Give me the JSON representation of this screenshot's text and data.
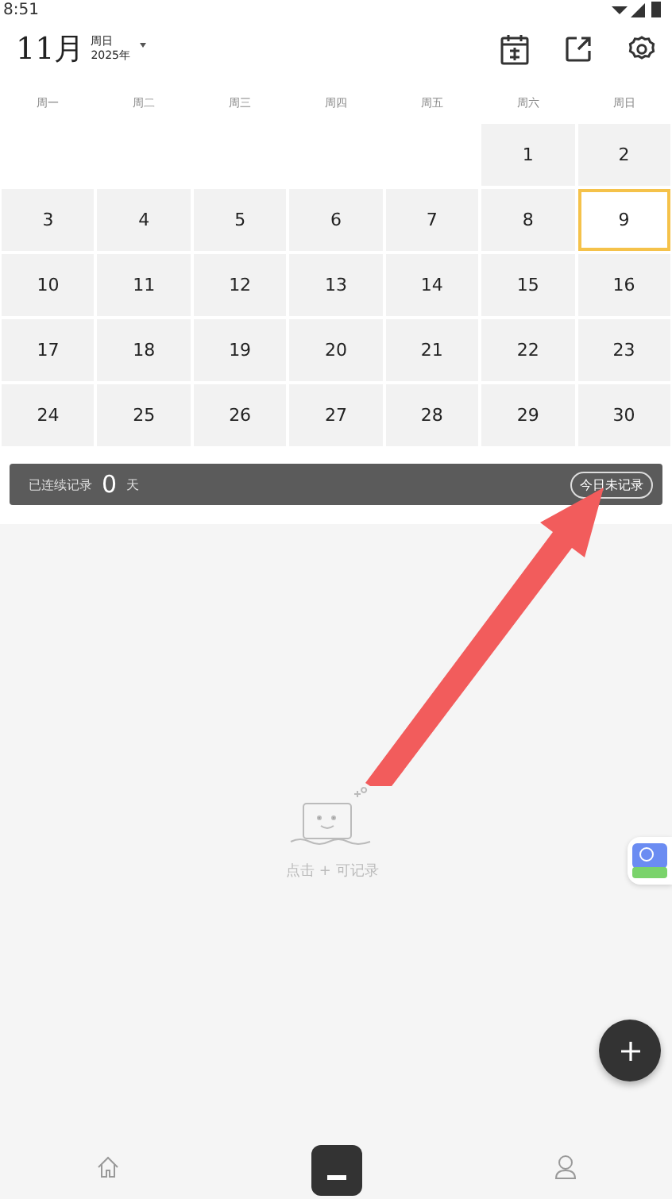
{
  "status_bar": {
    "time": "8:51"
  },
  "header": {
    "month": "11月",
    "weekday": "周日",
    "year": "2025年"
  },
  "weekdays": [
    "周一",
    "周二",
    "周三",
    "周四",
    "周五",
    "周六",
    "周日"
  ],
  "weeks": [
    [
      {
        "kind": "blank"
      },
      {
        "kind": "blank"
      },
      {
        "kind": "blank"
      },
      {
        "kind": "blank"
      },
      {
        "kind": "blank"
      },
      {
        "day": "1",
        "selected": false
      },
      {
        "day": "2",
        "selected": false
      }
    ],
    [
      {
        "day": "3",
        "selected": false
      },
      {
        "day": "4",
        "selected": false
      },
      {
        "day": "5",
        "selected": false
      },
      {
        "day": "6",
        "selected": false
      },
      {
        "day": "7",
        "selected": false
      },
      {
        "day": "8",
        "selected": false
      },
      {
        "day": "9",
        "selected": true
      }
    ],
    [
      {
        "day": "10",
        "selected": false
      },
      {
        "day": "11",
        "selected": false
      },
      {
        "day": "12",
        "selected": false
      },
      {
        "day": "13",
        "selected": false
      },
      {
        "day": "14",
        "selected": false
      },
      {
        "day": "15",
        "selected": false
      },
      {
        "day": "16",
        "selected": false
      }
    ],
    [
      {
        "day": "17",
        "selected": false
      },
      {
        "day": "18",
        "selected": false
      },
      {
        "day": "19",
        "selected": false
      },
      {
        "day": "20",
        "selected": false
      },
      {
        "day": "21",
        "selected": false
      },
      {
        "day": "22",
        "selected": false
      },
      {
        "day": "23",
        "selected": false
      }
    ],
    [
      {
        "day": "24",
        "selected": false
      },
      {
        "day": "25",
        "selected": false
      },
      {
        "day": "26",
        "selected": false
      },
      {
        "day": "27",
        "selected": false
      },
      {
        "day": "28",
        "selected": false
      },
      {
        "day": "29",
        "selected": false
      },
      {
        "day": "30",
        "selected": false
      }
    ]
  ],
  "streak": {
    "label": "已连续记录",
    "count": "0",
    "unit": "天",
    "button": "今日未记录"
  },
  "empty_state": {
    "text": "点击 + 可记录"
  }
}
